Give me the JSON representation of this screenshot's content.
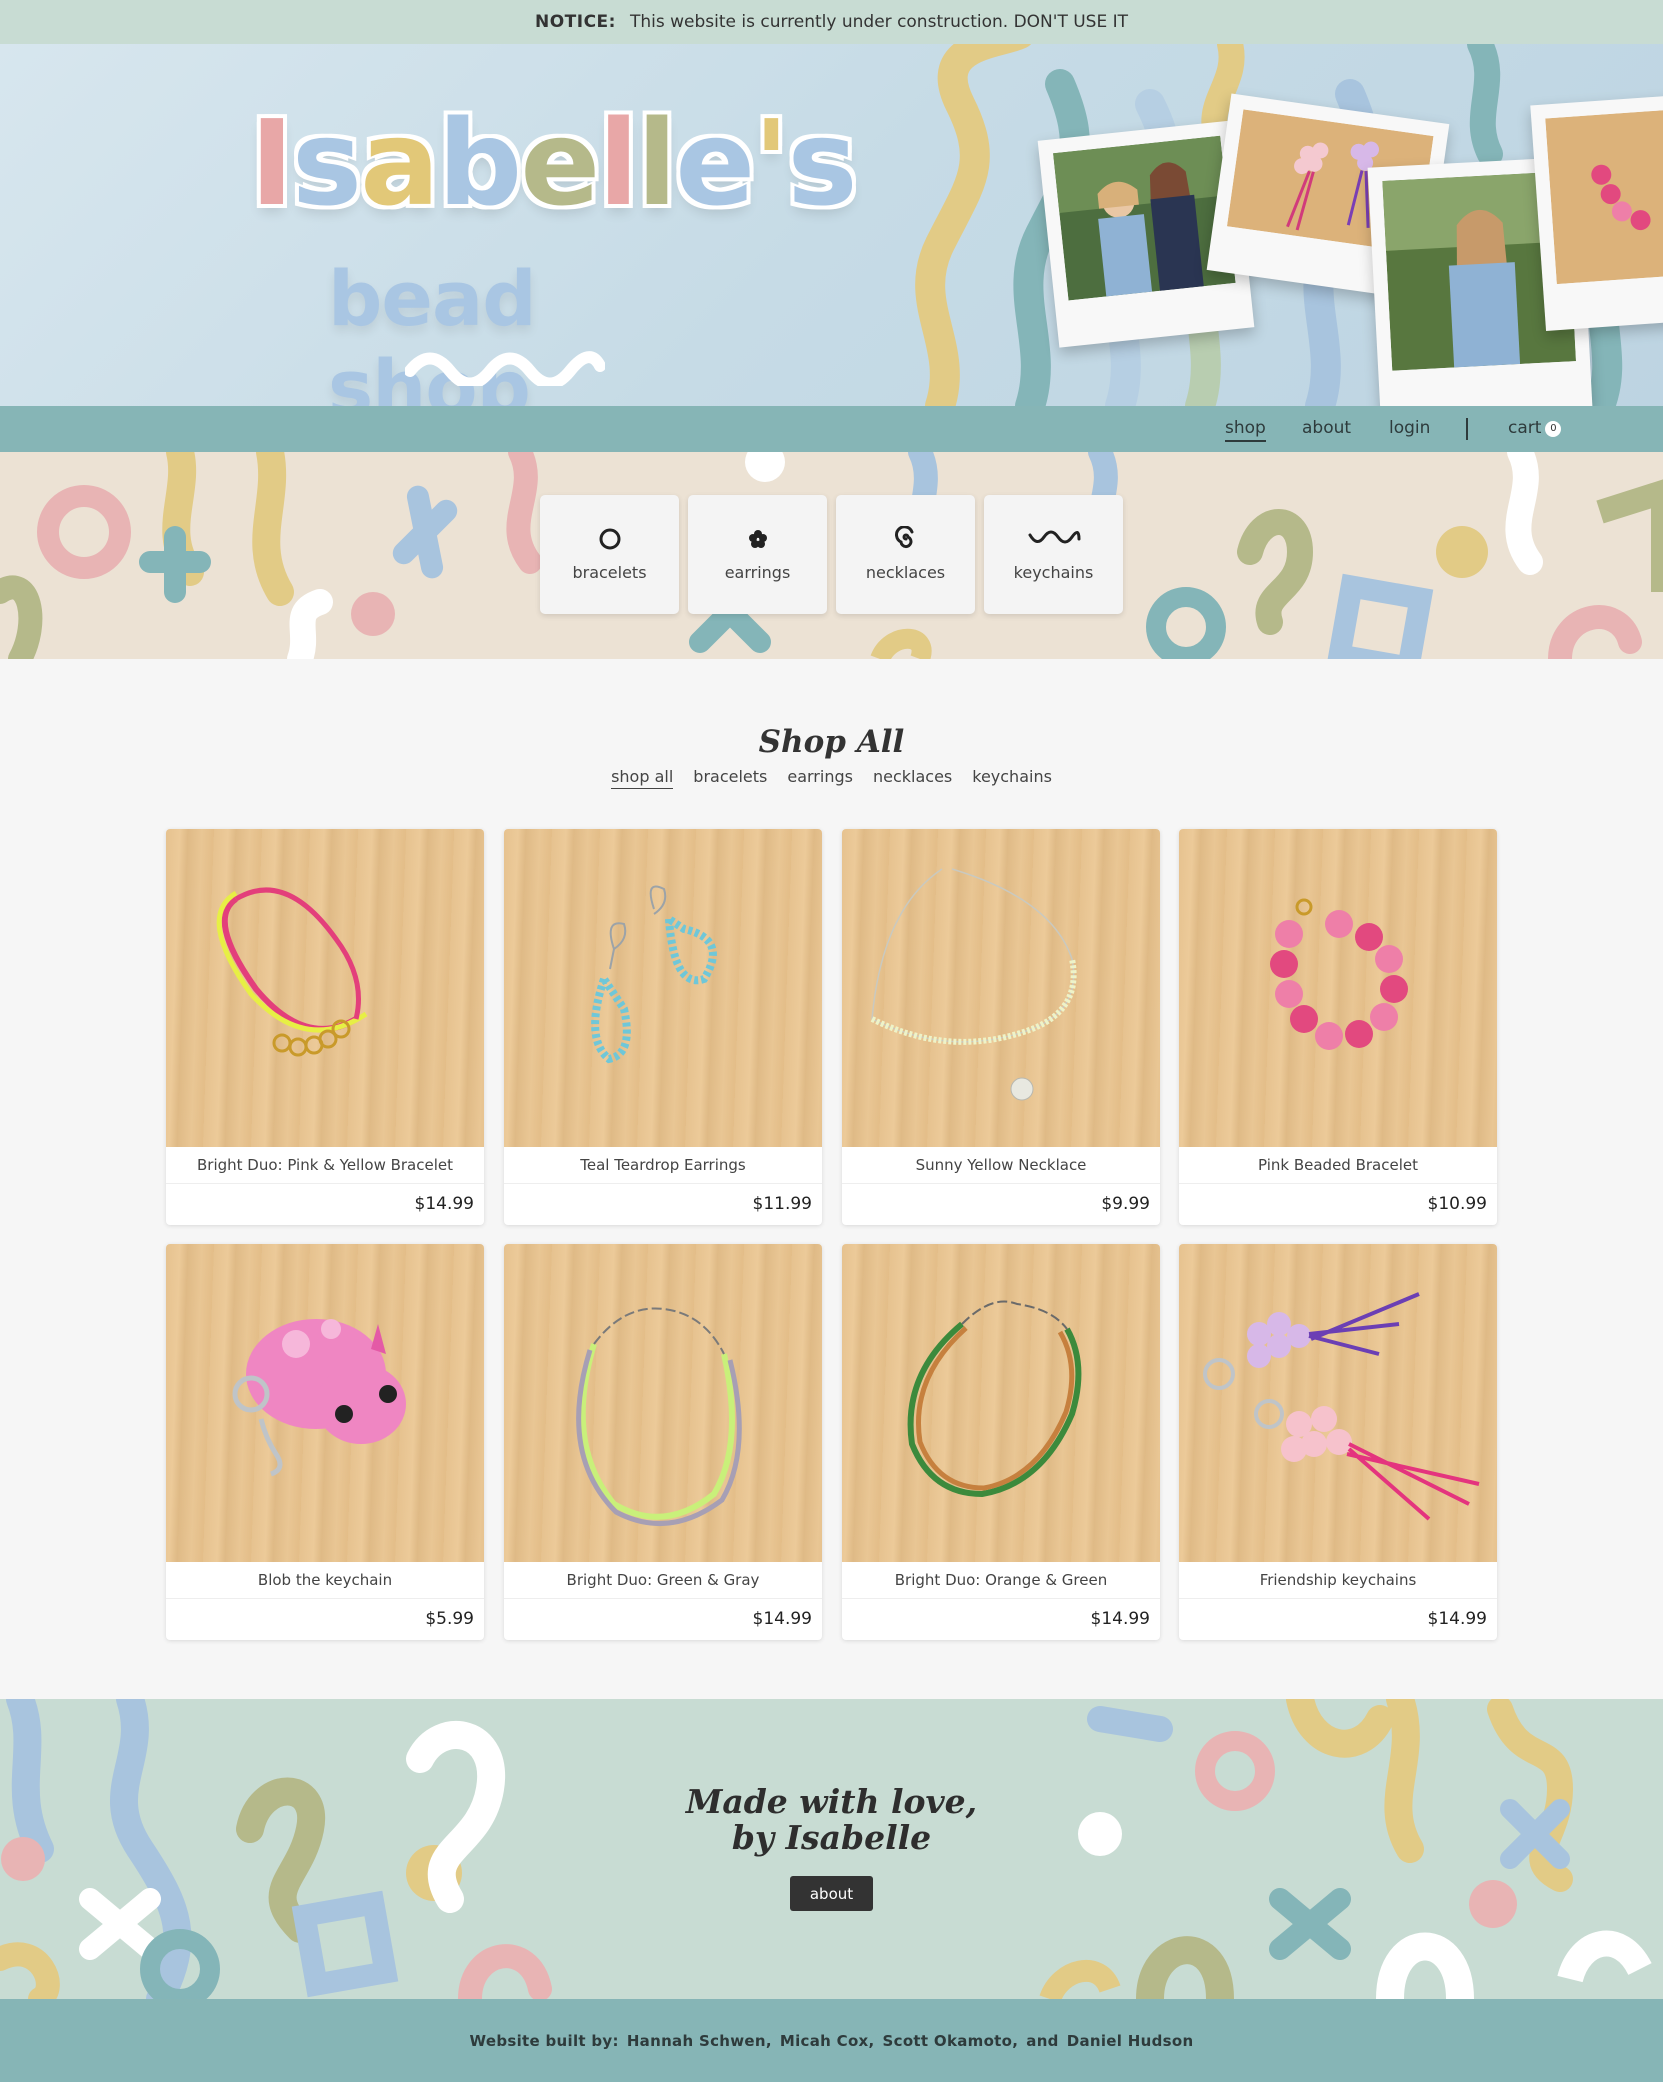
{
  "notice": {
    "label": "NOTICE:",
    "text": "This website is currently under construction. DON'T USE IT"
  },
  "logo": {
    "title_letters": [
      "I",
      "s",
      "a",
      "b",
      "e",
      "l",
      "l",
      "e",
      "'",
      "s"
    ],
    "subtitle": "bead shop"
  },
  "nav": {
    "shop": "shop",
    "about": "about",
    "login": "login",
    "cart": "cart",
    "cart_count": "0"
  },
  "categories": [
    {
      "label": "bracelets",
      "icon": "circle-icon"
    },
    {
      "label": "earrings",
      "icon": "flower-icon"
    },
    {
      "label": "necklaces",
      "icon": "spiral-icon"
    },
    {
      "label": "keychains",
      "icon": "wave-icon"
    }
  ],
  "shop": {
    "title": "Shop All",
    "filters": [
      "shop all",
      "bracelets",
      "earrings",
      "necklaces",
      "keychains"
    ],
    "products": [
      {
        "name": "Bright Duo: Pink & Yellow Bracelet",
        "price": "$14.99"
      },
      {
        "name": "Teal Teardrop Earrings",
        "price": "$11.99"
      },
      {
        "name": "Sunny Yellow Necklace",
        "price": "$9.99"
      },
      {
        "name": "Pink Beaded Bracelet",
        "price": "$10.99"
      },
      {
        "name": "Blob the keychain",
        "price": "$5.99"
      },
      {
        "name": "Bright Duo: Green & Gray",
        "price": "$14.99"
      },
      {
        "name": "Bright Duo: Orange & Green",
        "price": "$14.99"
      },
      {
        "name": "Friendship keychains",
        "price": "$14.99"
      }
    ]
  },
  "love": {
    "line1": "Made with love,",
    "line2": "by Isabelle",
    "button": "about"
  },
  "footer": {
    "prefix": "Website built by:",
    "names": [
      "Hannah Schwen,",
      "Micah Cox,",
      "Scott Okamoto,",
      "and",
      "Daniel Hudson"
    ]
  },
  "colors": {
    "notice_bg": "#c8dcd3",
    "nav_bg": "#86b5b6",
    "category_bg": "#ece2d4",
    "footer_bg": "#86b5b6",
    "love_bg": "#c8dcd3"
  }
}
